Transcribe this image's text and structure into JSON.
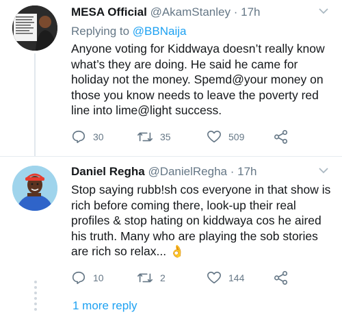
{
  "tweets": [
    {
      "display_name": "MESA Official",
      "handle": "@AkamStanley",
      "separator": "·",
      "time": "17h",
      "replying_prefix": "Replying to",
      "replying_handle": "@BBNaija",
      "text": "Anyone voting for Kiddwaya doesn’t really know what’s they are doing. He said he came for holiday not the money. Spemd@your money on those you know needs to leave the poverty red line into lime@light success.",
      "replies": "30",
      "retweets": "35",
      "likes": "509",
      "avatar_colors": {
        "bg": "#2b2b2b",
        "shirt": "#1c1c1c",
        "skin": "#7a4a2e",
        "slide": "#f2f2f2"
      }
    },
    {
      "display_name": "Daniel Regha",
      "handle": "@DanielRegha",
      "separator": "·",
      "time": "17h",
      "text": "Stop saying rubb!sh cos everyone in that show is rich before coming there, look-up their real profiles & stop hating on kiddwaya cos he aired his truth. Many who are playing the sob stories are rich so relax...",
      "emoji": "👌",
      "replies": "10",
      "retweets": "2",
      "likes": "144",
      "avatar_colors": {
        "bg": "#9fd4ec",
        "shirt": "#2f64c9",
        "skin": "#5a3320",
        "cap": "#e53d2f"
      }
    }
  ],
  "more_replies": "1 more reply",
  "colors": {
    "link": "#1da1f2",
    "muted": "#657786",
    "text": "#14171a"
  }
}
